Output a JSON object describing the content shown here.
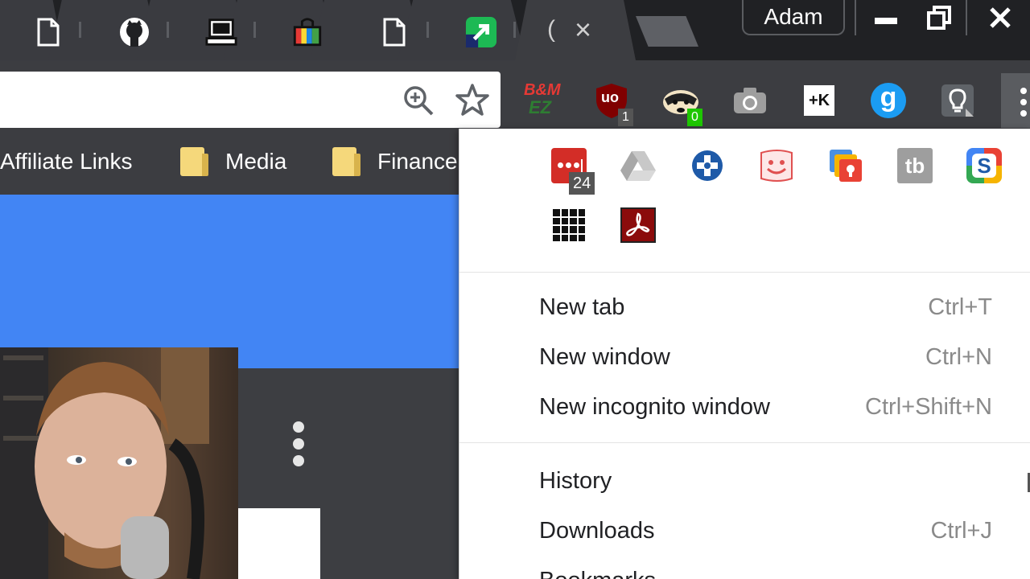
{
  "window": {
    "profile_name": "Adam",
    "active_tab_partial": "(",
    "active_tab_close": "×",
    "minimize_icon": "minimize-icon",
    "restore_icon": "restore-icon",
    "close_icon": "close-icon"
  },
  "tabs": [
    {
      "icon": "page-icon"
    },
    {
      "icon": "github-icon"
    },
    {
      "icon": "computer-icon"
    },
    {
      "icon": "shopping-bag-icon"
    },
    {
      "icon": "page-icon"
    },
    {
      "icon": "green-arrow-icon"
    }
  ],
  "toolbar": {
    "zoom_icon": "zoom-in-icon",
    "bookmark_star_icon": "star-icon",
    "extensions": [
      {
        "name": "B&M EZ",
        "icon": "bm-ez-icon",
        "label_top": "B&M",
        "label_bottom": "EZ"
      },
      {
        "name": "uBlock Origin",
        "icon": "ublock-origin-icon",
        "label": "uo",
        "badge": "1"
      },
      {
        "name": "Privacy Badger",
        "icon": "privacy-badger-icon",
        "badge": "0"
      },
      {
        "name": "Screenshot",
        "icon": "camera-icon"
      },
      {
        "name": "Keepa",
        "icon": "k-icon",
        "label": "+K"
      },
      {
        "name": "Grammarly",
        "icon": "grammarly-icon",
        "label": "g"
      },
      {
        "name": "Lightbulb",
        "icon": "lightbulb-icon"
      }
    ],
    "menu_icon": "menu-dots-icon"
  },
  "bookmarks": [
    {
      "label": "Affiliate Links"
    },
    {
      "label": "Media"
    },
    {
      "label": "Finance"
    }
  ],
  "menu": {
    "extensions": [
      {
        "icon": "lastpass-icon",
        "badge": "24"
      },
      {
        "icon": "google-drive-icon"
      },
      {
        "icon": "plus-circle-icon"
      },
      {
        "icon": "smiley-flag-icon"
      },
      {
        "icon": "google-keep-icon"
      },
      {
        "icon": "tb-icon",
        "label": "tb"
      },
      {
        "icon": "s-icon",
        "label": "S"
      },
      {
        "icon": "grid-icon"
      },
      {
        "icon": "acrobat-icon"
      }
    ],
    "items": [
      {
        "label": "New tab",
        "shortcut": "Ctrl+T"
      },
      {
        "label": "New window",
        "shortcut": "Ctrl+N"
      },
      {
        "label": "New incognito window",
        "shortcut": "Ctrl+Shift+N"
      },
      {
        "label": "History",
        "shortcut": ""
      },
      {
        "label": "Downloads",
        "shortcut": "Ctrl+J"
      },
      {
        "label": "Bookmarks",
        "shortcut": ""
      }
    ]
  },
  "colors": {
    "tabstrip": "#202124",
    "toolbar": "#3c3d41",
    "page_blue": "#4285f4",
    "menu_bg": "#ffffff",
    "menu_text": "#202124",
    "shortcut_text": "#8a8a8a"
  }
}
